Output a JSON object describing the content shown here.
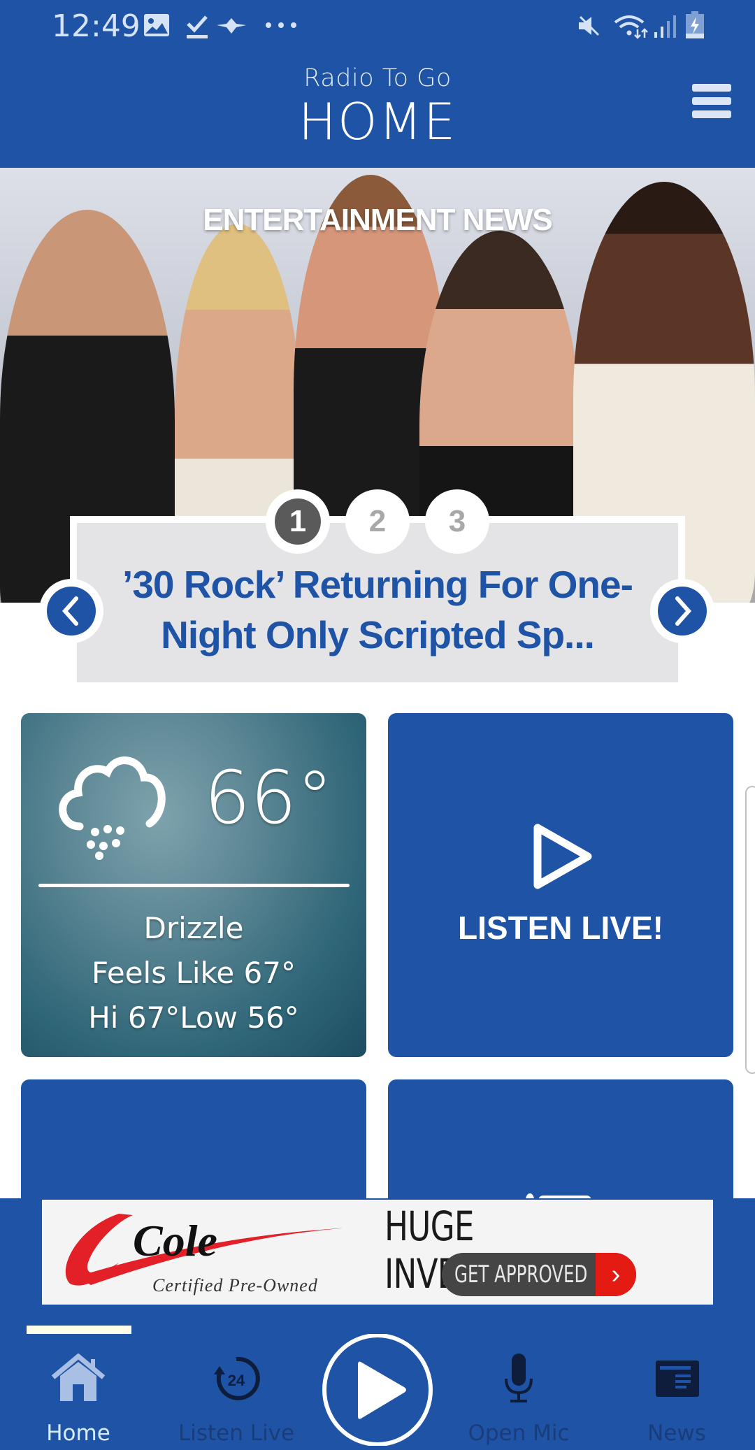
{
  "status_bar": {
    "time": "12:49",
    "left_icons": [
      "gallery-icon",
      "download-done-icon",
      "eagle-app-icon",
      "more-dots-icon"
    ],
    "right_icons": [
      "mute-icon",
      "wifi-icon",
      "signal-icon",
      "battery-charging-icon"
    ]
  },
  "header": {
    "app_name": "Radio To Go",
    "title": "HOME",
    "menu_icon": "hamburger-menu-icon"
  },
  "hero": {
    "category_label": "ENTERTAINMENT NEWS",
    "headline": "’30 Rock’ Returning For One-Night Only Scripted Sp...",
    "pages": [
      "1",
      "2",
      "3"
    ],
    "active_page": 1,
    "prev_icon": "chevron-left-icon",
    "next_icon": "chevron-right-icon"
  },
  "weather": {
    "icon": "drizzle-cloud-icon",
    "temperature": "66°",
    "condition": "Drizzle",
    "feels_like": "Feels Like 67°",
    "hi_low": "Hi 67°Low 56°"
  },
  "listen_tile": {
    "icon": "play-outline-icon",
    "label": "LISTEN LIVE!"
  },
  "ad": {
    "brand": "Cole",
    "tagline": "Certified Pre-Owned",
    "headline": "HUGE INVENTORY",
    "cta": "GET APPROVED",
    "cta_arrow": "›"
  },
  "bottom_nav": {
    "items": [
      {
        "label": "Home",
        "icon": "home-icon",
        "active": true
      },
      {
        "label": "Listen Live",
        "icon": "replay-24-icon",
        "active": false
      },
      {
        "label": "",
        "icon": "play-circle-icon",
        "active": false
      },
      {
        "label": "Open Mic",
        "icon": "microphone-icon",
        "active": false
      },
      {
        "label": "News",
        "icon": "newspaper-icon",
        "active": false
      }
    ]
  },
  "colors": {
    "brand_blue": "#1e53a6",
    "active_dot": "#5a5a5a",
    "inactive_dot_text": "#a8a8a8",
    "headline_blue": "#1e53a6",
    "ad_red": "#e31b12"
  }
}
